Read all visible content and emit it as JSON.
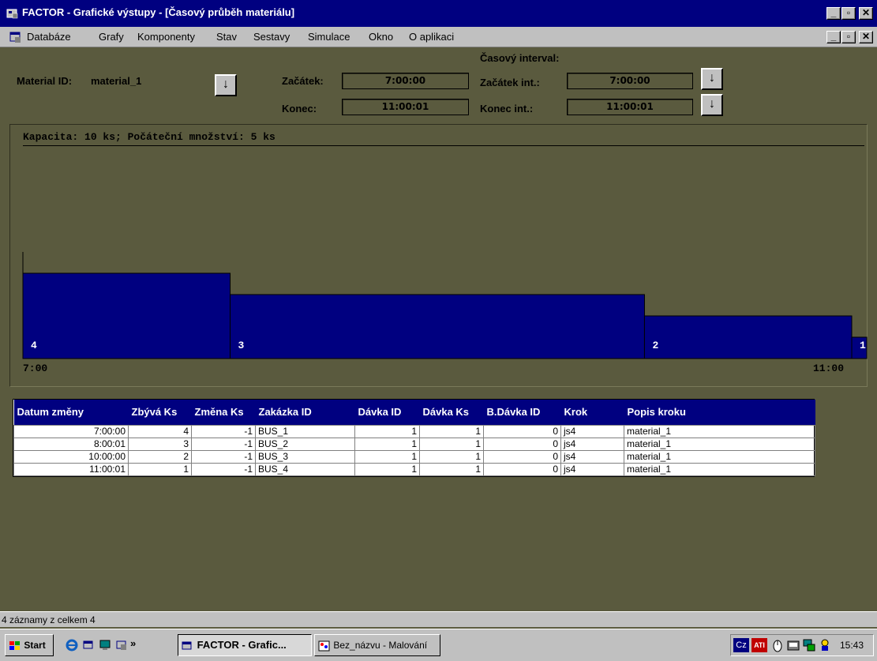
{
  "window": {
    "title": "FACTOR - Grafické výstupy - [Časový průběh materiálu]",
    "buttons": {
      "minimize": "_",
      "restore": "▫",
      "close": "✕"
    }
  },
  "menu": {
    "items": [
      "Databáze",
      "Grafy",
      "Komponenty",
      "Stav",
      "Sestavy",
      "Simulace",
      "Okno",
      "O aplikaci"
    ]
  },
  "header": {
    "material_label": "Material ID:",
    "material_value": "material_1",
    "interval_title": "Časový interval:",
    "start_label": "Začátek:",
    "start_value": "7:00:00",
    "end_label": "Konec:",
    "end_value": "11:00:01",
    "start_int_label": "Začátek int.:",
    "start_int_value": "7:00:00",
    "end_int_label": "Konec int.:",
    "end_int_value": "11:00:01",
    "arrow": "↓"
  },
  "chart_data": {
    "type": "area",
    "caption": "Kapacita: 10 ks; Počáteční množství: 5 ks",
    "capacity": 10,
    "x_start": "7:00:00",
    "x_end": "11:00:01",
    "x_tick_labels": [
      "7:00",
      "11:00"
    ],
    "steps": [
      {
        "from": "7:00:00",
        "to": "8:00:01",
        "value": 4,
        "label": "4"
      },
      {
        "from": "8:00:01",
        "to": "10:00:00",
        "value": 3,
        "label": "3"
      },
      {
        "from": "10:00:00",
        "to": "11:00:01",
        "value": 2,
        "label": "2"
      },
      {
        "from": "11:00:01",
        "to": "11:00:01",
        "value": 1,
        "label": "1"
      }
    ],
    "initial_value": 5,
    "bar_color": "#000080"
  },
  "table": {
    "columns": [
      "Datum změny",
      "Zbývá Ks",
      "Změna Ks",
      "Zakázka ID",
      "Dávka ID",
      "Dávka Ks",
      "B.Dávka ID",
      "Krok",
      "Popis kroku"
    ],
    "rows": [
      [
        "7:00:00",
        "4",
        "-1",
        "BUS_1",
        "1",
        "1",
        "0",
        "js4",
        "material_1"
      ],
      [
        "8:00:01",
        "3",
        "-1",
        "BUS_2",
        "1",
        "1",
        "0",
        "js4",
        "material_1"
      ],
      [
        "10:00:00",
        "2",
        "-1",
        "BUS_3",
        "1",
        "1",
        "0",
        "js4",
        "material_1"
      ],
      [
        "11:00:01",
        "1",
        "-1",
        "BUS_4",
        "1",
        "1",
        "0",
        "js4",
        "material_1"
      ]
    ]
  },
  "status": {
    "text": "4 záznamy z celkem 4"
  },
  "taskbar": {
    "start_label": "Start",
    "more_glyph": "»",
    "tasks": [
      "FACTOR - Grafic...",
      "Bez_názvu - Malování"
    ],
    "tray_lang": "Cz",
    "tray_ati": "ATI",
    "clock": "15:43"
  },
  "colors": {
    "titlebar": "#000080",
    "panel_bg": "#5a5a3e",
    "chrome": "#c0c0c0",
    "bar": "#000080"
  }
}
